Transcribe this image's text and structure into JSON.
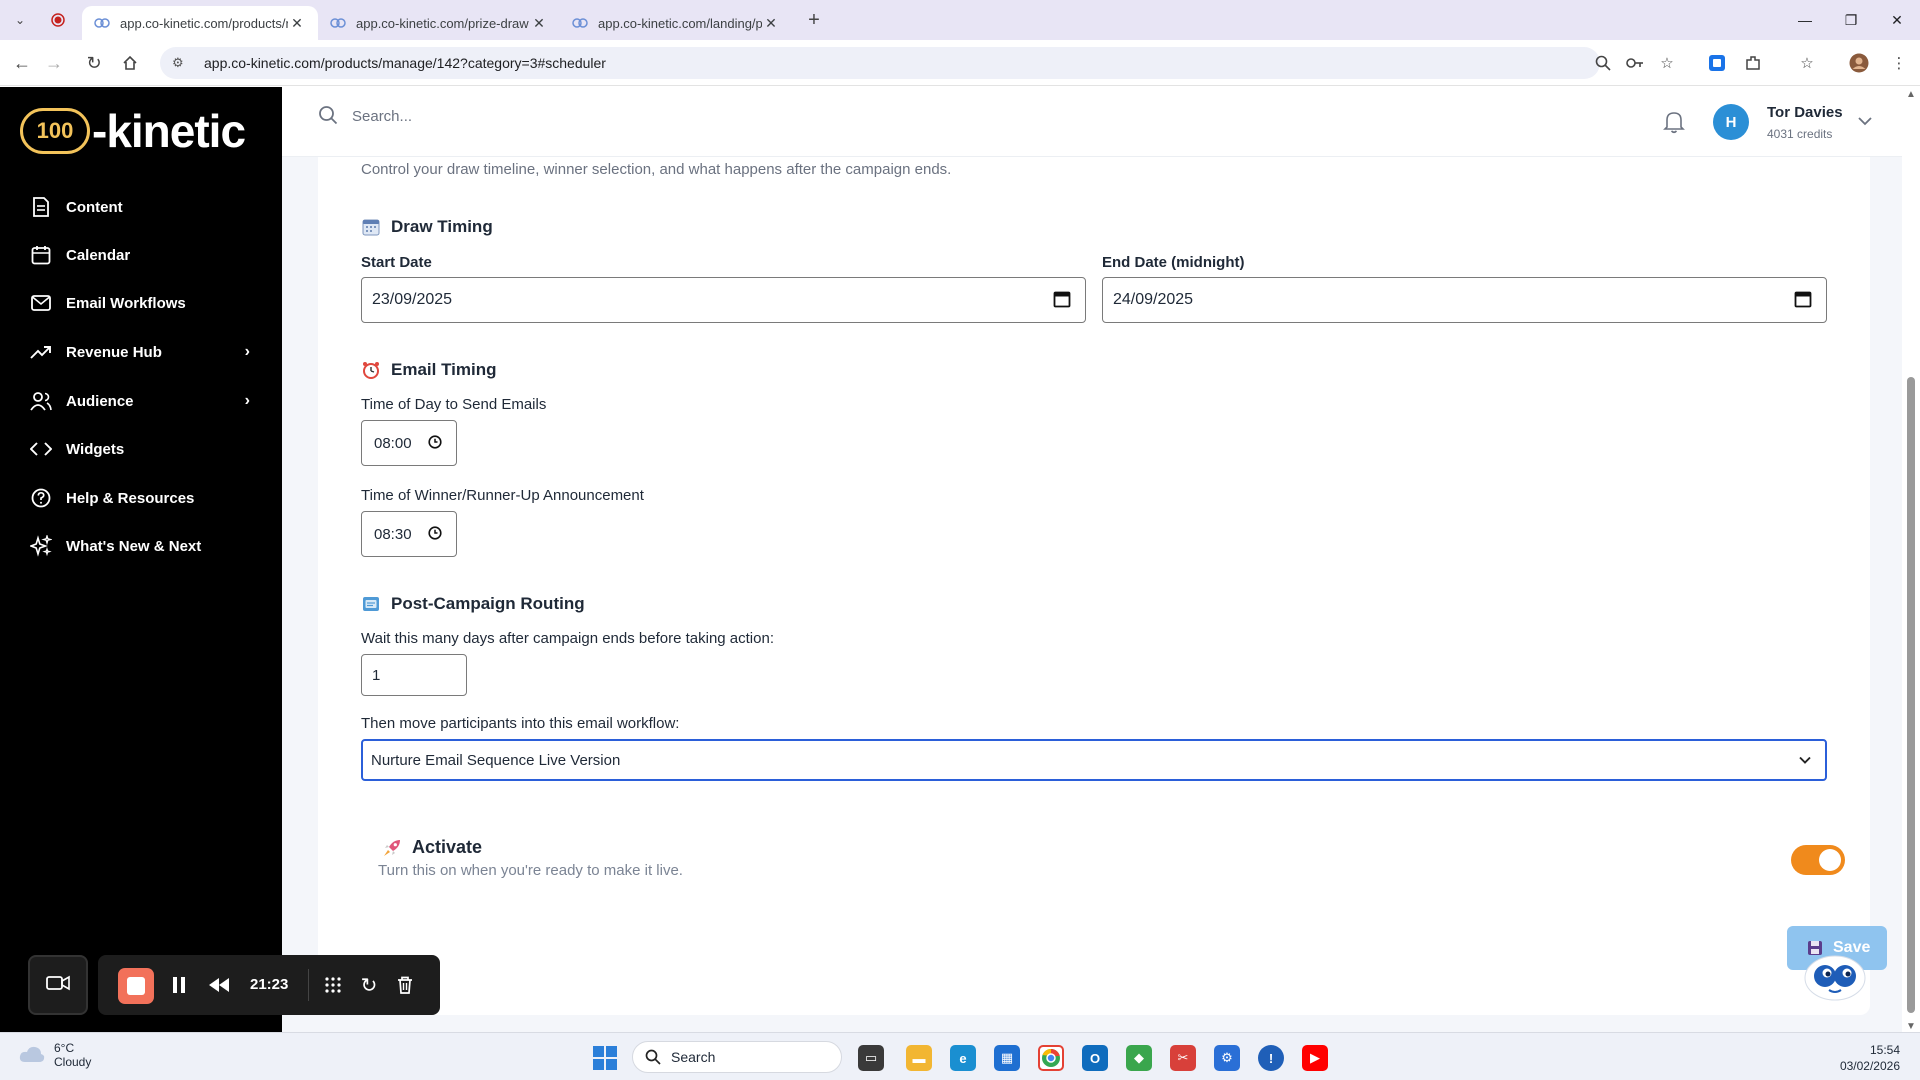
{
  "browser": {
    "tabs": [
      {
        "title": "app.co-kinetic.com/products/m",
        "active": true
      },
      {
        "title": "app.co-kinetic.com/prize-draw",
        "active": false
      },
      {
        "title": "app.co-kinetic.com/landing/pr",
        "active": false
      }
    ],
    "url": "app.co-kinetic.com/products/manage/142?category=3#scheduler"
  },
  "app": {
    "logo_text": "-kinetic",
    "logo_mark": "100"
  },
  "sidebar": {
    "items": [
      {
        "label": "Content",
        "icon": "document-icon"
      },
      {
        "label": "Calendar",
        "icon": "calendar-icon"
      },
      {
        "label": "Email Workflows",
        "icon": "mail-icon"
      },
      {
        "label": "Revenue Hub",
        "icon": "trend-icon"
      },
      {
        "label": "Audience",
        "icon": "users-icon"
      },
      {
        "label": "Widgets",
        "icon": "code-icon"
      },
      {
        "label": "Help & Resources",
        "icon": "help-icon"
      },
      {
        "label": "What's New & Next",
        "icon": "sparkle-icon"
      }
    ]
  },
  "topbar": {
    "search_placeholder": "Search...",
    "avatar_initial": "H",
    "user_name": "Tor Davies",
    "credits": "4031 credits"
  },
  "scheduler": {
    "intro": "Control your draw timeline, winner selection, and what happens after the campaign ends.",
    "draw_timing": {
      "title": "Draw Timing",
      "start_label": "Start Date",
      "start_value": "23/09/2025",
      "end_label": "End Date (midnight)",
      "end_value": "24/09/2025"
    },
    "email_timing": {
      "title": "Email Timing",
      "send_label": "Time of Day to Send Emails",
      "send_value": "08:00",
      "announce_label": "Time of Winner/Runner-Up Announcement",
      "announce_value": "08:30"
    },
    "routing": {
      "title": "Post-Campaign Routing",
      "wait_label": "Wait this many days after campaign ends before taking action:",
      "wait_value": "1",
      "workflow_label": "Then move participants into this email workflow:",
      "workflow_value": "Nurture Email Sequence Live Version"
    },
    "activate": {
      "title": "Activate",
      "description": "Turn this on when you're ready to make it live.",
      "enabled": true
    },
    "save_label": "Save"
  },
  "recorder": {
    "time": "21:23"
  },
  "taskbar": {
    "temperature": "6°C",
    "condition": "Cloudy",
    "search_label": "Search",
    "time": "15:54",
    "date": "03/02/2026"
  },
  "colors": {
    "accent": "#f08a1c",
    "select_border": "#2b5fd9",
    "save_button": "#8fc4ef",
    "avatar": "#2b8fd6"
  }
}
